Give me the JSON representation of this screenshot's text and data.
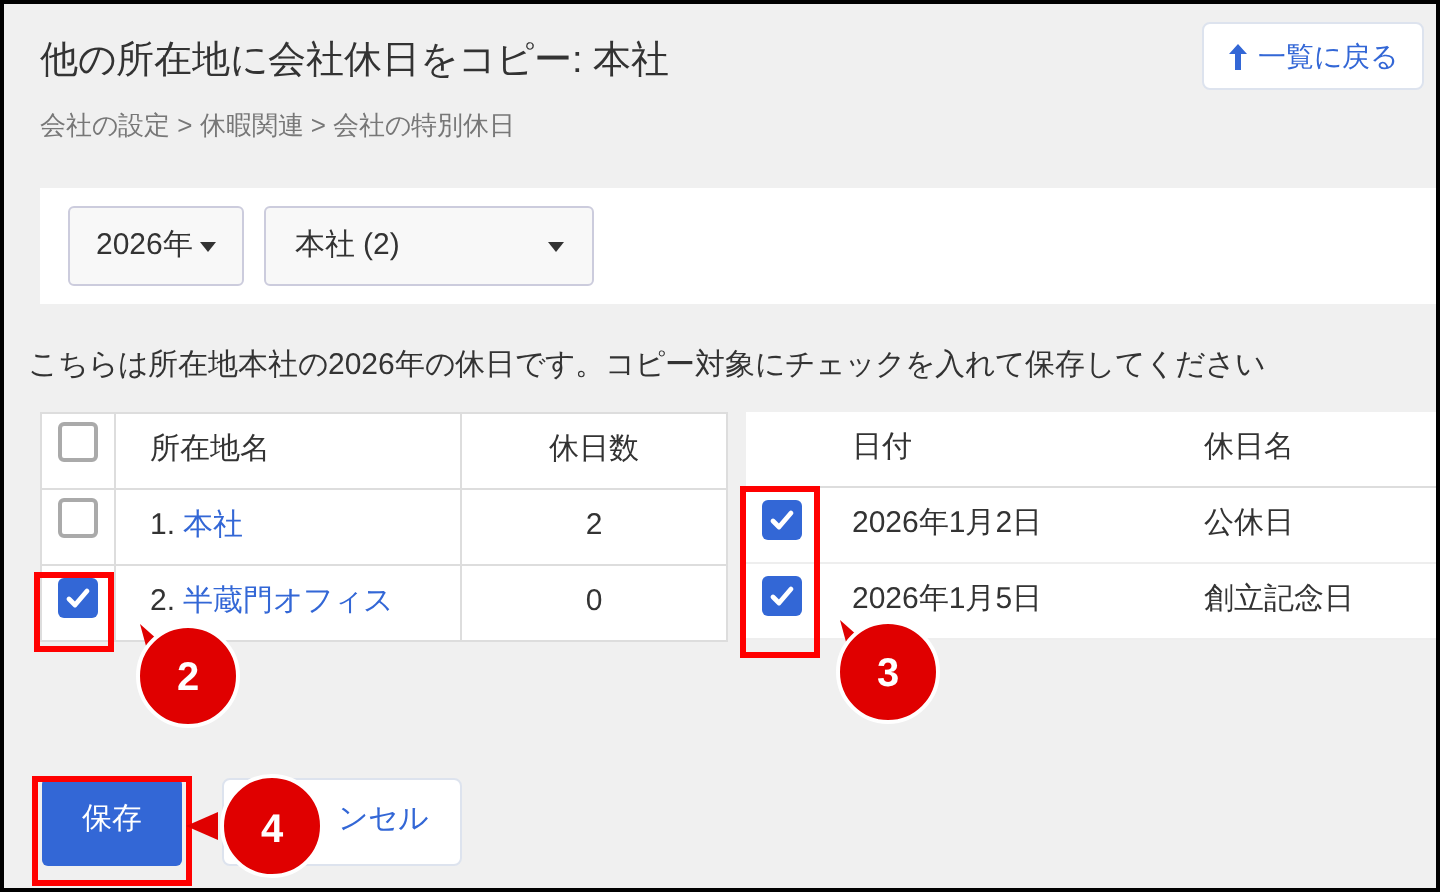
{
  "page": {
    "title": "他の所在地に会社休日をコピー: 本社",
    "back_button": "一覧に戻る",
    "breadcrumb": "会社の設定 > 休暇関連 > 会社の特別休日"
  },
  "filters": {
    "year": "2026年",
    "location": "本社 (2)"
  },
  "message": "こちらは所在地本社の2026年の休日です。コピー対象にチェックを入れて保存してください",
  "locations_table": {
    "select_all_checked": false,
    "columns": [
      "所在地名",
      "休日数"
    ],
    "rows": [
      {
        "number": "1.",
        "name": "本社",
        "count": "2",
        "checked": false
      },
      {
        "number": "2.",
        "name": "半蔵門オフィス",
        "count": "0",
        "checked": true
      }
    ]
  },
  "holidays_table": {
    "columns": [
      "日付",
      "休日名"
    ],
    "rows": [
      {
        "date": "2026年1月2日",
        "name": "公休日",
        "checked": true
      },
      {
        "date": "2026年1月5日",
        "name": "創立記念日",
        "checked": true
      }
    ]
  },
  "buttons": {
    "save": "保存",
    "cancel": "ンセル"
  },
  "annotations": [
    {
      "kind": "callout",
      "label": "2"
    },
    {
      "kind": "callout",
      "label": "3"
    },
    {
      "kind": "callout",
      "label": "4"
    }
  ]
}
